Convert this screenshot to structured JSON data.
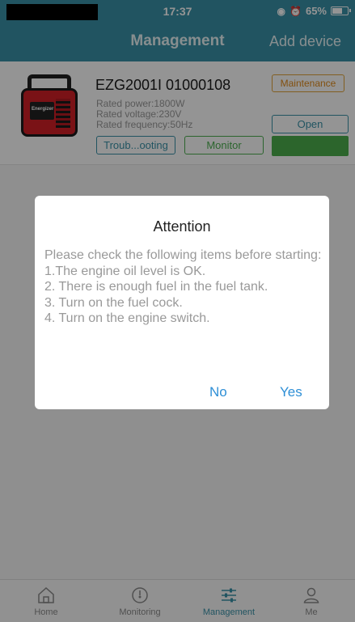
{
  "status_bar": {
    "time": "17:37",
    "battery": "65%"
  },
  "nav": {
    "title": "Management",
    "action": "Add device"
  },
  "device": {
    "name": "EZG2001I 01000108",
    "brand": "Energizer",
    "specs": [
      "Rated power:1800W",
      "Rated voltage:230V",
      "Rated frequency:50Hz"
    ],
    "buttons": {
      "troubleshooting": "Troub...ooting",
      "monitor": "Monitor",
      "maintenance": "Maintenance",
      "open": "Open"
    }
  },
  "dialog": {
    "title": "Attention",
    "body": [
      "Please check the following items before starting:",
      " 1.The engine oil level is OK.",
      "2. There is enough fuel in the fuel tank.",
      "3. Turn on the fuel cock.",
      "4. Turn on the engine switch."
    ],
    "no_label": "No",
    "yes_label": "Yes"
  },
  "tabs": [
    {
      "label": "Home",
      "icon": "home-icon"
    },
    {
      "label": "Monitoring",
      "icon": "gauge-icon"
    },
    {
      "label": "Management",
      "icon": "sliders-icon"
    },
    {
      "label": "Me",
      "icon": "user-icon"
    }
  ],
  "colors": {
    "accent": "#3a92a8",
    "monitor": "#4caf50",
    "maintenance": "#e08a1a",
    "dialog_button": "#2e8fd6"
  }
}
